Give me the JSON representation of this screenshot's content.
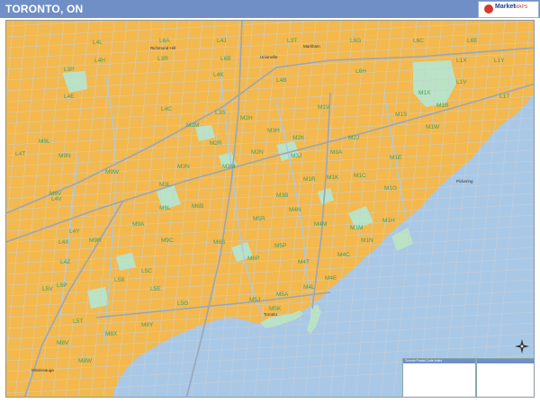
{
  "header": {
    "title": "TORONTO, ON"
  },
  "logo": {
    "text": "Market",
    "sub": "MAPS"
  },
  "map": {
    "colors": {
      "land": "#f3b94e",
      "water": "#a9c8e6",
      "park": "#b9e3c4",
      "road": "#c7cfd8",
      "highway": "#98a6bb",
      "frame": "#6f8fc6"
    },
    "postal_codes": [
      "L4L",
      "L6A",
      "L4J",
      "L3T",
      "L6G",
      "L6C",
      "L6E",
      "L4H",
      "L3R",
      "L6B",
      "L1X",
      "L1Y",
      "L3P",
      "L4K",
      "L4B",
      "L6H",
      "L1V",
      "M1X",
      "M1B",
      "L1T",
      "L4E",
      "L4C",
      "L3S",
      "M1S",
      "M1V",
      "M2H",
      "M2M",
      "M3H",
      "M2K",
      "M2J",
      "M1W",
      "M1E",
      "M9L",
      "M2R",
      "M2N",
      "M3J",
      "M3A",
      "M1C",
      "M9N",
      "M3N",
      "M3M",
      "M1K",
      "M1R",
      "M1G",
      "M3B",
      "M9V",
      "M9W",
      "M3L",
      "M6L",
      "M6B",
      "M5R",
      "M4N",
      "M4M",
      "M1H",
      "M9A",
      "M9R",
      "M9C",
      "M6S",
      "M6P",
      "M5P",
      "M4T",
      "M4C",
      "M1N",
      "L4T",
      "L4V",
      "L4Y",
      "L4X",
      "L4Z",
      "L5P",
      "L5T",
      "M8X",
      "M8Y",
      "M5A",
      "M4L",
      "M4E",
      "M1M",
      "L5V",
      "L5B",
      "L5C",
      "L5E",
      "L5G",
      "M8V",
      "M8W",
      "M5J",
      "M5K"
    ],
    "place_names": [
      "Richmond Hill",
      "Unionville",
      "Mississauga",
      "Markham",
      "Pickering",
      "Toronto"
    ]
  },
  "legend": {
    "title": "Toronto Postal Code Index"
  }
}
